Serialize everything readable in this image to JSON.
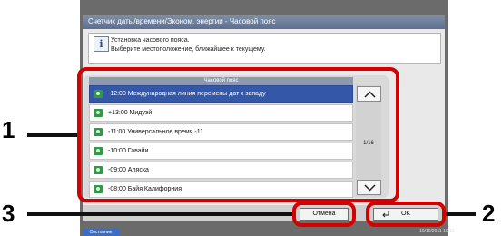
{
  "dialog": {
    "title": "Счетчик даты/времени/Эконом. энергии - Часовой пояс",
    "info_line1": "Установка часового пояса.",
    "info_line2": "Выберите местоположение, ближайшее к текущему.",
    "info_icon": "info-icon"
  },
  "timezone_list": {
    "header": "Часовой пояс",
    "selected_index": 0,
    "items": [
      "-12:00 Международная линия перемены дат к западу",
      "+13:00 Мидуэй",
      "-11:00 Универсальное время -11",
      "-10:00 Гавайи",
      "-09:00 Аляска",
      "-08:00 Байя Калифорния"
    ],
    "page_indicator": "1/16"
  },
  "buttons": {
    "cancel": "Отмена",
    "ok": "OK"
  },
  "statusbar": {
    "status": "Состояние",
    "clock": "10/10/2011  10:10"
  },
  "callouts": [
    "1",
    "2",
    "3"
  ],
  "colors": {
    "accent": "#3557a8",
    "callout": "#d40000",
    "titlebar": "#5f7090"
  }
}
